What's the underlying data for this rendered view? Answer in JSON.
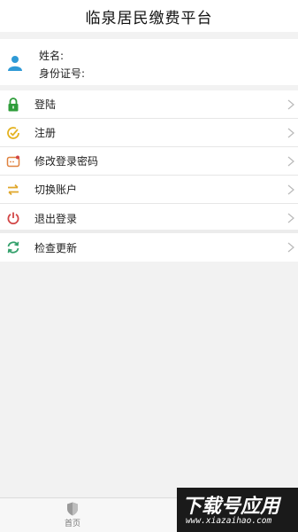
{
  "header": {
    "title": "临泉居民缴费平台"
  },
  "user": {
    "name_label": "姓名:",
    "id_label": "身份证号:",
    "avatar_icon": "user-icon"
  },
  "menu": [
    {
      "label": "登陆",
      "icon": "lock-icon",
      "color": "#2e9d3a"
    },
    {
      "label": "注册",
      "icon": "clock-check-icon",
      "color": "#e4b21f"
    },
    {
      "label": "修改登录密码",
      "icon": "password-icon",
      "color": "#e0823f"
    },
    {
      "label": "切换账户",
      "icon": "swap-icon",
      "color": "#e0a62a"
    },
    {
      "label": "退出登录",
      "icon": "power-icon",
      "color": "#d24545"
    }
  ],
  "menu2": [
    {
      "label": "检查更新",
      "icon": "refresh-icon",
      "color": "#33a06b"
    }
  ],
  "tabbar": {
    "home_label": "首页"
  },
  "watermark": {
    "big": "下载号应用",
    "small": "www.xiazaihao.com"
  }
}
